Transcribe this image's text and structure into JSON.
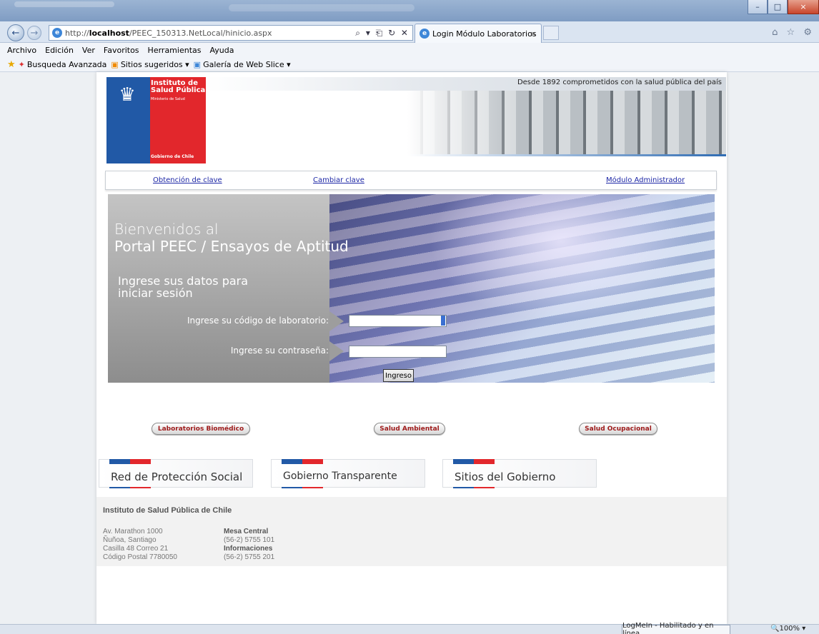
{
  "browser": {
    "address": "http://localhost/PEEC_150313.NetLocal/hinicio.aspx",
    "address_prefix": "http://",
    "address_host": "localhost",
    "address_rest": "/PEEC_150313.NetLocal/hinicio.aspx",
    "address_tools": "⌕ ▾ ⎗ ↻ ✕",
    "tab_title": "Login Módulo Laboratorios",
    "tab_close": "×",
    "window_buttons": {
      "minimize": "–",
      "maximize": "□",
      "close": "×"
    },
    "right_icons": "⌂ ☆ ⚙",
    "menu": [
      "Archivo",
      "Edición",
      "Ver",
      "Favoritos",
      "Herramientas",
      "Ayuda"
    ],
    "favorites": [
      "Busqueda Avanzada",
      "Sitios sugeridos ▾",
      "Galería de Web Slice ▾"
    ],
    "status_logmein": "LogMeIn - Habilitado y en línea",
    "zoom": "🔍100%  ▾"
  },
  "header": {
    "logo_line1": "Instituto de",
    "logo_line2": "Salud Pública",
    "logo_ministry": "Ministerio de Salud",
    "logo_gob": "Gobierno de Chile",
    "slogan": "Desde 1892 comprometidos con la salud pública del país"
  },
  "links": {
    "obtencion": "Obtención de clave",
    "cambiar": "Cambiar clave",
    "admin": "Módulo Administrador"
  },
  "login": {
    "welcome_line1": "Bienvenidos al",
    "welcome_line2": "Portal PEEC / Ensayos de Aptitud",
    "instruction_line1": "Ingrese sus datos para",
    "instruction_line2": "iniciar sesión",
    "code_label": "Ingrese su código de laboratorio:",
    "code_value": "",
    "password_label": "Ingrese su contraseña:",
    "password_value": "",
    "submit": "Ingreso"
  },
  "sections": [
    "Laboratorios Biomédico",
    "Salud Ambiental",
    "Salud Ocupacional"
  ],
  "gov_links": [
    "Red de Protección Social",
    "Gobierno Transparente",
    "Sitios del Gobierno"
  ],
  "footer": {
    "title": "Instituto de Salud Pública de Chile",
    "address": [
      "Av. Marathon 1000",
      "Ñuñoa, Santiago",
      "Casilla 48 Correo 21",
      "Código Postal 7780050"
    ],
    "mesa_label": "Mesa Central",
    "mesa_phone": "(56-2) 5755 101",
    "info_label": "Informaciones",
    "info_phone": "(56-2) 5755 201"
  },
  "colors": {
    "blue": "#2159a6",
    "red": "#e2272c",
    "link": "#1d27a6",
    "pill_text": "#9e1a1a"
  }
}
